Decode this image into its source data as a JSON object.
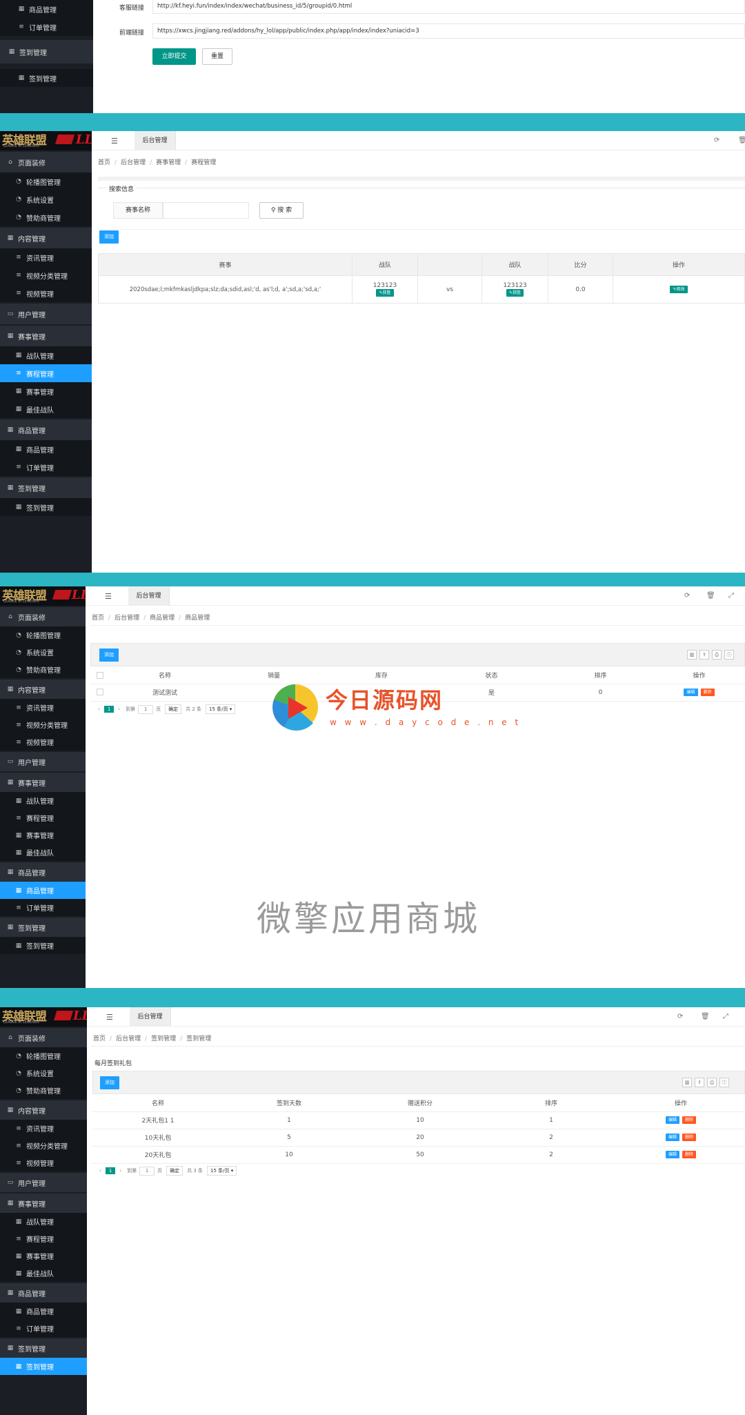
{
  "menu_icons": {
    "home": "home-icon",
    "gauge": "gauge-icon",
    "list": "list-icon",
    "calendar": "calendar-icon",
    "user": "user-icon"
  },
  "panel1": {
    "sidebar_items": [
      "商品管理",
      "订单管理",
      "签到管理",
      "签到管理"
    ],
    "fields": [
      {
        "label": "客服链接",
        "value": "http://kf.heyi.fun/index/index/wechat/business_id/5/groupid/0.html"
      },
      {
        "label": "前端链接",
        "value": "https://xwcs.jingjiang.red/addons/hy_lol/app/public/index.php/app/index/index?uniacid=3"
      }
    ],
    "submit_label": "立即提交",
    "reset_label": "重置"
  },
  "logo": {
    "cn": "英雄联盟",
    "en": "LEAGUE of LEGENDS",
    "mark": "LL"
  },
  "sidebar": {
    "groups": [
      "页面装修",
      "内容管理",
      "用户管理",
      "赛事管理",
      "商品管理",
      "签到管理"
    ],
    "items": [
      "轮播图管理",
      "系统设置",
      "赞助商管理",
      "资讯管理",
      "视频分类管理",
      "视频管理",
      "战队管理",
      "赛程管理",
      "赛事管理",
      "最佳战队",
      "商品管理",
      "订单管理",
      "签到管理"
    ]
  },
  "tab_label": "后台管理",
  "panel2": {
    "breadcrumb": [
      "首页",
      "后台管理",
      "赛事管理",
      "赛程管理"
    ],
    "search_legend": "搜索信息",
    "search_label": "赛事名称",
    "search_placeholder": "",
    "search_button": "搜 索",
    "add_button": "添加",
    "columns": [
      "赛事",
      "战队",
      "",
      "战队",
      "比分",
      "操作"
    ],
    "row": {
      "event": "2020sdae;l;mkfmkasljdkpa;slz;da;sdid,asl;'d, as'l;d, a';sd,a;'sd,a;'",
      "team1": "123123",
      "vs": "vs",
      "team2": "123123",
      "score": "0.0",
      "team_btn": "获胜",
      "action": "修改"
    }
  },
  "panel3": {
    "breadcrumb": [
      "首页",
      "后台管理",
      "商品管理",
      "商品管理"
    ],
    "add_button": "添加",
    "columns": [
      "名称",
      "销量",
      "库存",
      "状态",
      "排序",
      "操作"
    ],
    "row": {
      "name": "测试测试",
      "sales": "",
      "stock": "111",
      "status": "是",
      "sort": "0",
      "edit": "编辑",
      "delete": "删除"
    },
    "pager": {
      "page": "1",
      "goto": "到第",
      "page_unit": "页",
      "ok": "确定",
      "total": "共 2 条",
      "per_page": "15 条/页"
    }
  },
  "panel4": {
    "breadcrumb": [
      "首页",
      "后台管理",
      "签到管理",
      "签到管理"
    ],
    "section_title": "每月签到礼包",
    "add_button": "添加",
    "columns": [
      "名称",
      "签到天数",
      "赠送积分",
      "排序",
      "操作"
    ],
    "rows": [
      {
        "name": "2天礼包1 1",
        "days": "1",
        "points": "10",
        "sort": "1"
      },
      {
        "name": "10天礼包",
        "days": "5",
        "points": "20",
        "sort": "2"
      },
      {
        "name": "20天礼包",
        "days": "10",
        "points": "50",
        "sort": "2"
      }
    ],
    "edit": "编辑",
    "delete": "删除",
    "pager": {
      "page": "1",
      "goto": "到第",
      "page_unit": "页",
      "ok": "确定",
      "total": "共 3 条",
      "per_page": "15 条/页"
    }
  },
  "watermark": {
    "brand": "今日源码网",
    "url": "w w w . d a y c o d e . n e t",
    "bottom": "微擎应用商城"
  },
  "colors": {
    "accent_blue": "#1e9fff",
    "teal": "#009688",
    "separator": "#2cb6c4",
    "danger": "#ff5722",
    "sidebar": "#1b1e24"
  }
}
